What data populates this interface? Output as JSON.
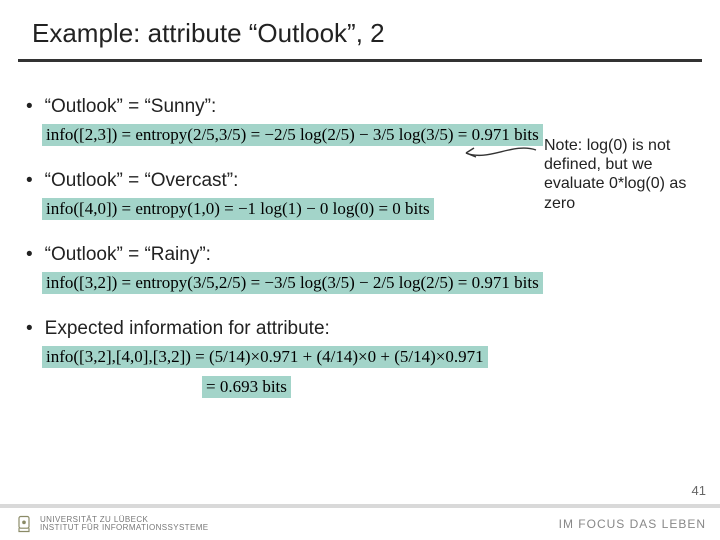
{
  "title": "Example: attribute “Outlook”, 2",
  "bullets": {
    "sunny": "“Outlook” = “Sunny”:",
    "overcast": "“Outlook” = “Overcast”:",
    "rainy": "“Outlook” = “Rainy”:",
    "expected": "Expected information for attribute:"
  },
  "formulas": {
    "sunny": "info([2,3]) = entropy(2/5,3/5) = −2/5 log(2/5) − 3/5 log(3/5) = 0.971 bits",
    "overcast": "info([4,0]) = entropy(1,0) = −1 log(1) − 0 log(0) = 0 bits",
    "rainy": "info([3,2]) = entropy(3/5,2/5) = −3/5 log(3/5) − 2/5 log(2/5) = 0.971 bits",
    "expected1": "info([3,2],[4,0],[3,2]) = (5/14)×0.971 + (4/14)×0 + (5/14)×0.971",
    "expected2": "= 0.693 bits"
  },
  "note": "Note: log(0) is not defined, but we evaluate 0*log(0) as zero",
  "footer": {
    "uni_line1": "UNIVERSITÄT ZU LÜBECK",
    "uni_line2": "INSTITUT FÜR INFORMATIONSSYSTEME",
    "tagline": "IM FOCUS DAS LEBEN",
    "page": "41"
  }
}
